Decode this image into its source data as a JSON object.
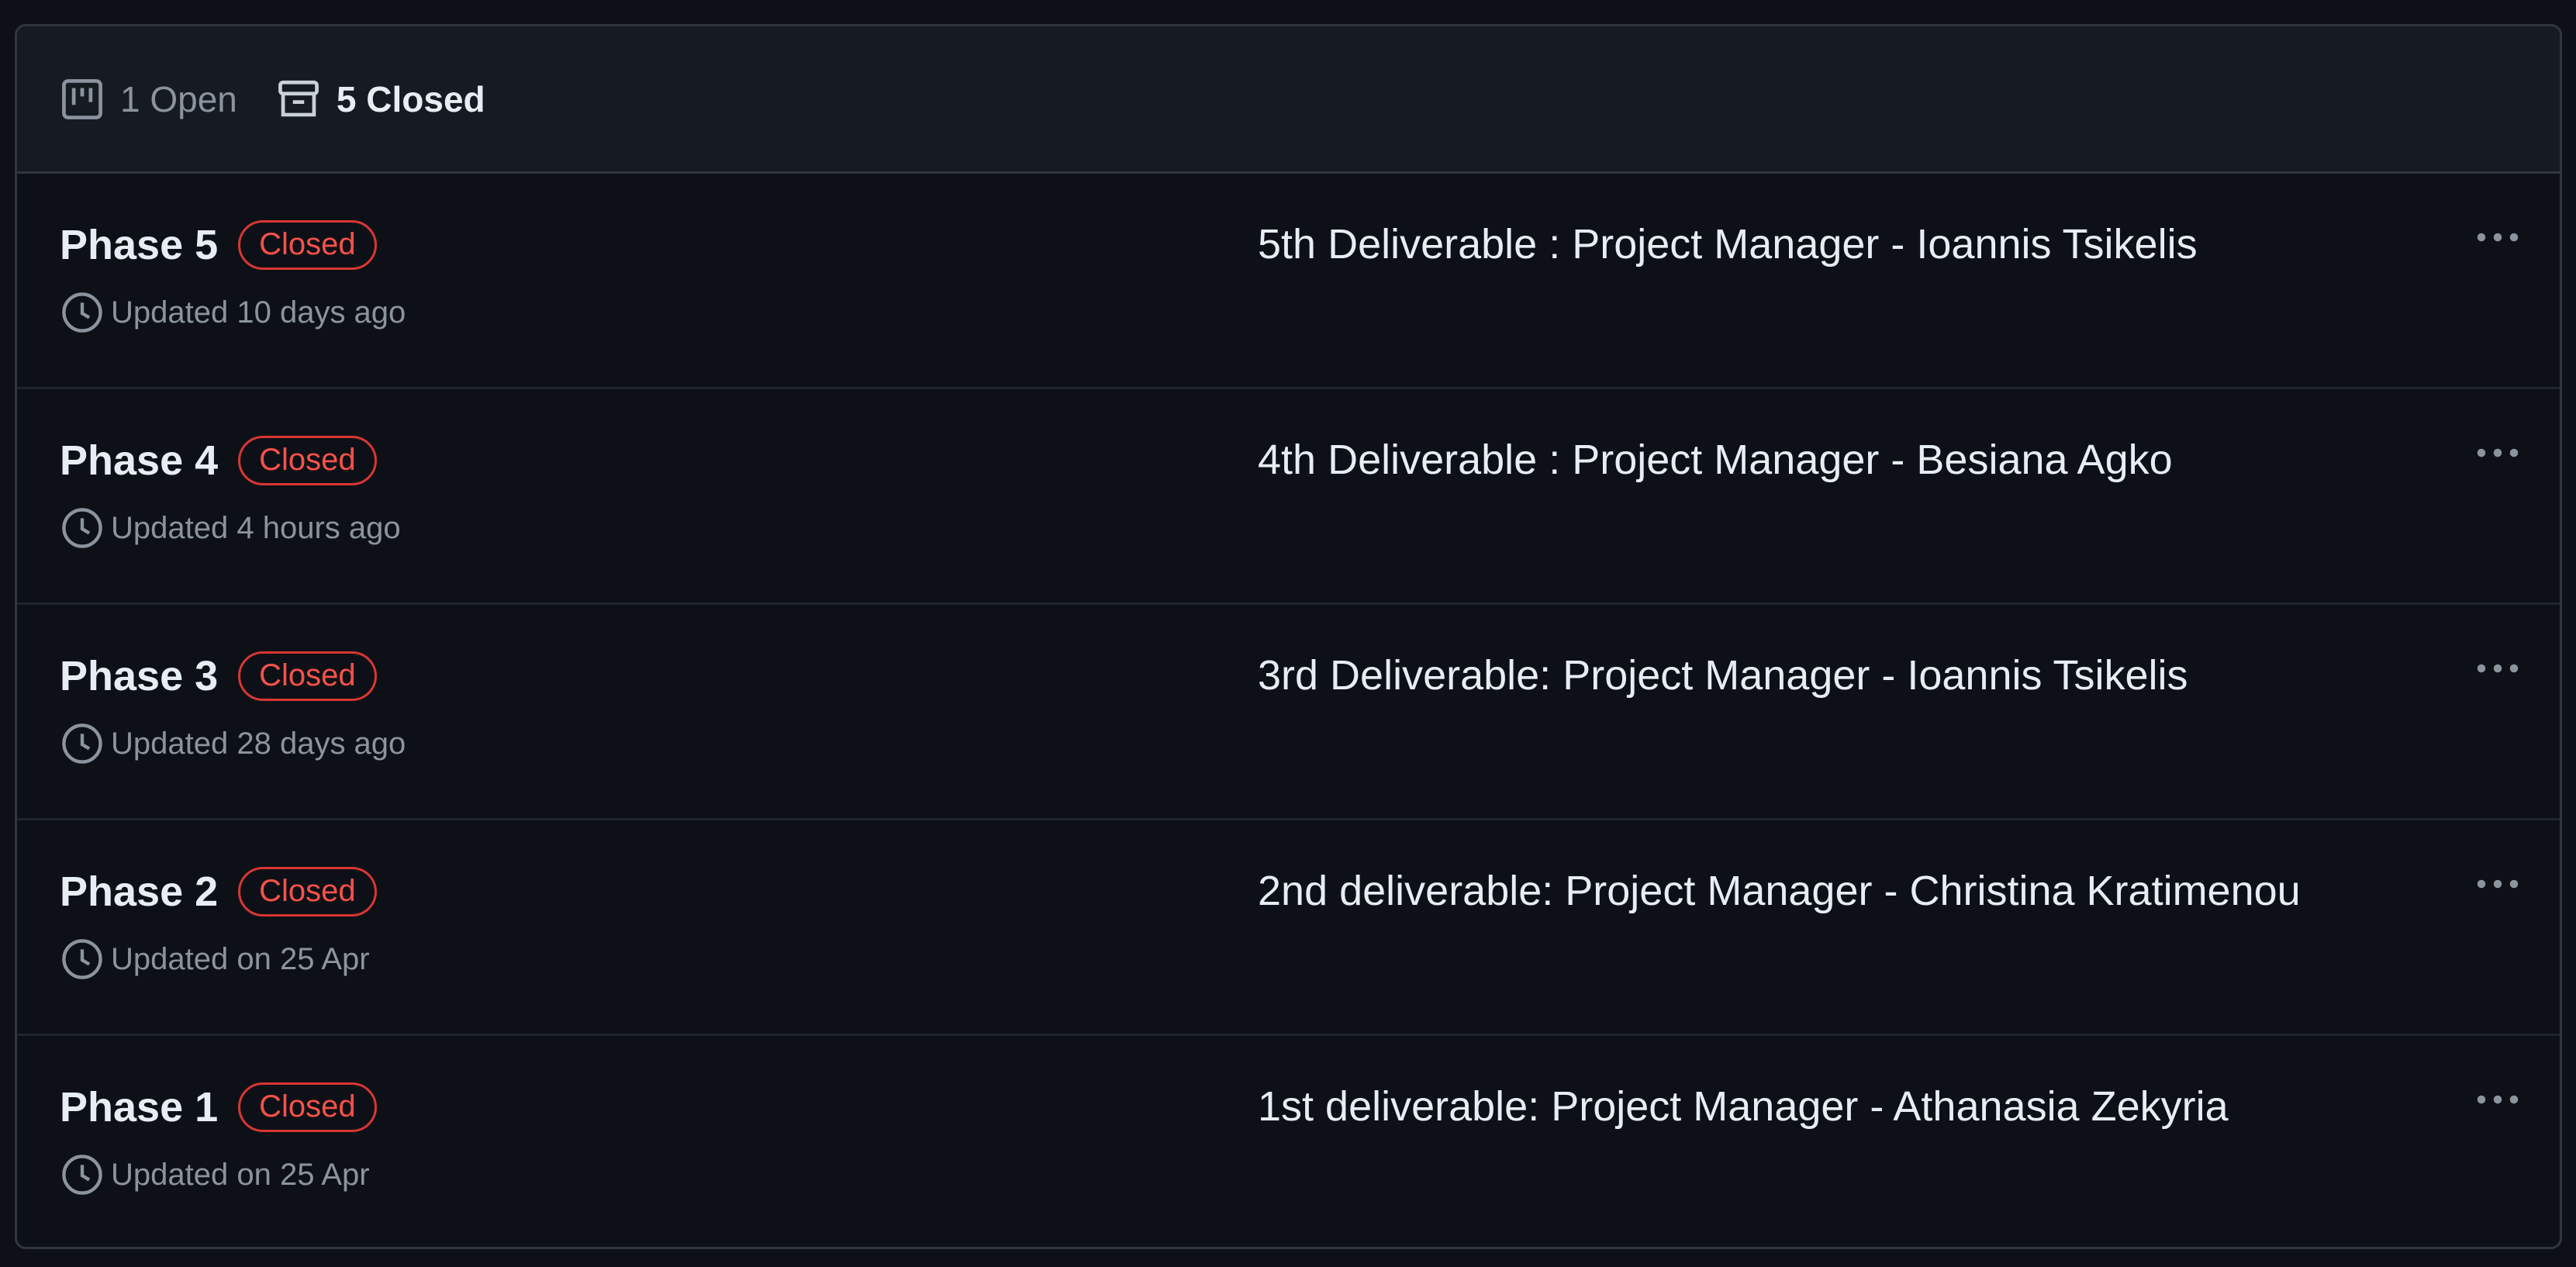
{
  "header": {
    "open_label": "1 Open",
    "closed_label": "5 Closed"
  },
  "milestones": [
    {
      "name": "Phase 5",
      "status": "Closed",
      "updated": "Updated 10 days ago",
      "description": "5th Deliverable : Project Manager - Ioannis Tsikelis"
    },
    {
      "name": "Phase 4",
      "status": "Closed",
      "updated": "Updated 4 hours ago",
      "description": "4th Deliverable : Project Manager - Besiana Agko"
    },
    {
      "name": "Phase 3",
      "status": "Closed",
      "updated": "Updated 28 days ago",
      "description": "3rd Deliverable: Project Manager - Ioannis Tsikelis"
    },
    {
      "name": "Phase 2",
      "status": "Closed",
      "updated": "Updated on 25 Apr",
      "description": "2nd deliverable: Project Manager - Christina Kratimenou"
    },
    {
      "name": "Phase 1",
      "status": "Closed",
      "updated": "Updated on 25 Apr",
      "description": "1st deliverable: Project Manager - Athanasia Zekyria"
    }
  ],
  "icons": {
    "open": "project-board-icon",
    "closed": "archive-box-icon",
    "updated": "clock-icon",
    "more": "kebab-horizontal-icon"
  },
  "colors": {
    "background": "#0d1117",
    "header_bg": "#161b22",
    "closed_badge": "#f85149",
    "muted_text": "#8b949e"
  }
}
